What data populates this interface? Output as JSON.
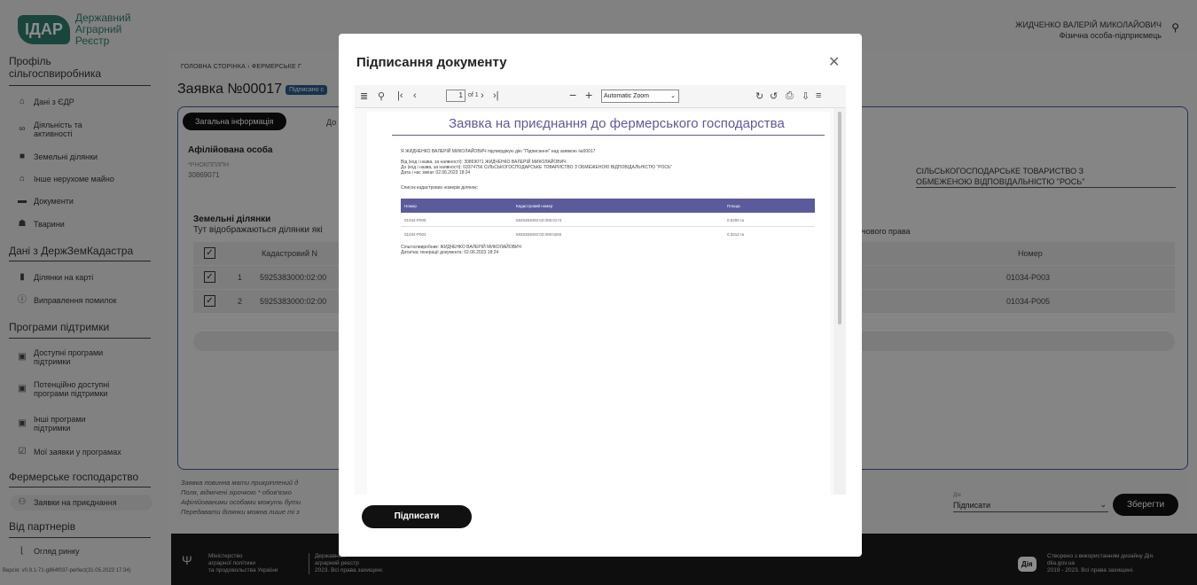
{
  "logo": {
    "badge": "ІДАР",
    "line1": "Державний",
    "line2": "Аграрний",
    "line3": "Реєстр"
  },
  "sidebar": {
    "section1": "Профіль сільгоспвиробника",
    "items1": [
      "Дані з ЄДР",
      "Діяльність та активності",
      "Земельні ділянки",
      "Інше нерухоме майно",
      "Документи",
      "Тварини"
    ],
    "section2": "Дані з ДержЗемКадастра",
    "items2": [
      "Ділянки на карті",
      "Виправлення помилок"
    ],
    "section3": "Програми підтримки",
    "items3": [
      "Доступні програми підтримки",
      "Потенційно доступні програми підтримки",
      "Інші програми підтримки",
      "Мої заявки у програмах"
    ],
    "section4": "Фермерське господарство",
    "items4": [
      "Заявки на приєднання"
    ],
    "section5": "Від партнерів",
    "items5": [
      "Огляд ринку"
    ],
    "version": "Версія: v0.9.1-71-g864f037-perfect(31.05.2023 17:34)"
  },
  "user": {
    "name": "ЖИДЧЕНКО ВАЛЕРІЙ МИКОЛАЙОВИЧ",
    "role": "Фізична особа-підприємець"
  },
  "breadcrumb": "ГОЛОВНА СТОРІНКА  ›  ФЕРМЕРСЬКЕ Г",
  "app": {
    "title": "Заявка №00017",
    "badge": "Підписано с"
  },
  "tabs": {
    "active": "Загальна інформація",
    "second": "До"
  },
  "affiliate": {
    "title": "Афілійована особа",
    "label": "*РНОКПП/ІПН",
    "value": "30869071"
  },
  "org": {
    "line1": "СІЛЬСЬКОГОСПОДАРСЬКЕ ТОВАРИСТВО З",
    "line2": "ОБМЕЖЕНОЮ ВІДПОВІДАЛЬНІСТЮ \"РОСЬ\""
  },
  "land": {
    "title": "Земельні ділянки",
    "subtitle": "Тут відображаються ділянки які",
    "right_label": "чового права"
  },
  "table": {
    "header": {
      "cadastral": "Кадастровий N",
      "number": "Номер"
    },
    "rows": [
      {
        "n": "1",
        "cadastral": "5925383000:02:00",
        "number": "01034-P003"
      },
      {
        "n": "2",
        "cadastral": "5925383000:02:00",
        "number": "01034-P005"
      }
    ]
  },
  "notes": [
    "Заявка повинна мати прикріплений д",
    "Поля, відмічені зірочкою * обов'язко",
    "Афілійованими особами можуть бути",
    "Передавати ділянки можна лише ті з"
  ],
  "bottom": {
    "sign_label": "Дія",
    "sign_value": "Підписати",
    "save": "Зберегти"
  },
  "footer": {
    "ministry1": "Міністерство",
    "ministry2": "аграрної політики",
    "ministry3": "та продовольства України",
    "reg1": "Державний",
    "reg2": "аграрний реєстр",
    "reg3": "2023. Всі права захищені.",
    "diia": "Дія",
    "credit1": "Створено з використанням дизайну Дія.",
    "credit2": "diia.gov.ua",
    "credit3": "2019 - 2023. Всі права захищені."
  },
  "modal": {
    "title": "Підписання документу",
    "toolbar": {
      "page": "1",
      "of": "of 1",
      "zoom": "Automatic Zoom"
    },
    "pdf": {
      "title": "Заявка на приєднання до фермерського господарства",
      "lines": [
        "Я ЖИДЧЕНКО ВАЛЕРІЙ МИКОЛАЙОВИЧ підтверджую дію \"Підписання\" над заявкою №00017",
        "Від (код і назва, за наявності): 30869071 ЖИДЧЕНКО ВАЛЕРІЙ МИКОЛАЙОВИЧ",
        "До (код і назва, за наявності): 03374756 СІЛЬСЬКОГОСПОДАРСЬКЕ ТОВАРИСТВО З ОБМЕЖЕНОЮ ВІДПОВІДАЛЬНІСТЮ \"РОСЬ\"",
        "Дата і час зміни: 02.06.2023 18:24",
        "Список кадастрових номерів ділянок:"
      ],
      "table_header": [
        "Номер",
        "Кадастровий номер",
        "Площа"
      ],
      "table_rows": [
        [
          "01034-P005",
          "5925383000:02:008:0174",
          "0.5250 га"
        ],
        [
          "01034-P003",
          "5925383000:02:008:0250",
          "0.3312 га"
        ]
      ],
      "footer_lines": [
        "Сільгоспвиробник: ЖИДЧЕНКО ВАЛЕРІЙ МИКОЛАЙОВИЧ",
        "Дата/час генерації документа: 02.06.2023 18:24"
      ]
    },
    "sign_button": "Підписати"
  }
}
